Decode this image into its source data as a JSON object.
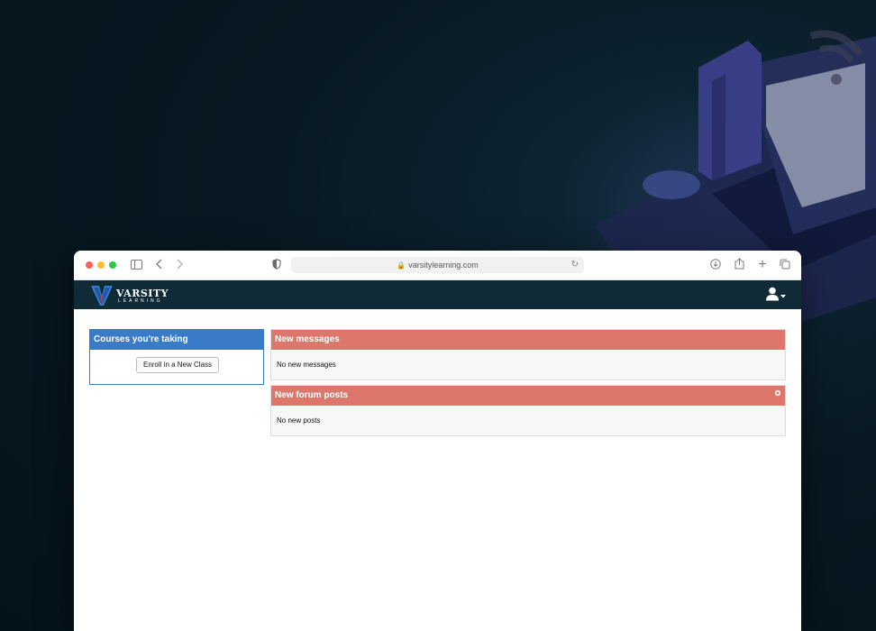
{
  "browser": {
    "url": "varsitylearning.com"
  },
  "site": {
    "logo_main": "VARSITY",
    "logo_sub": "LEARNING"
  },
  "courses_panel": {
    "title": "Courses you're taking",
    "enroll_button": "Enroll in a New Class"
  },
  "messages_panel": {
    "title": "New messages",
    "body": "No new messages"
  },
  "forum_panel": {
    "title": "New forum posts",
    "body": "No new posts"
  },
  "colors": {
    "navbar": "#0f2b38",
    "courses_header": "#3a7bc8",
    "alert_header": "#dd776b"
  }
}
